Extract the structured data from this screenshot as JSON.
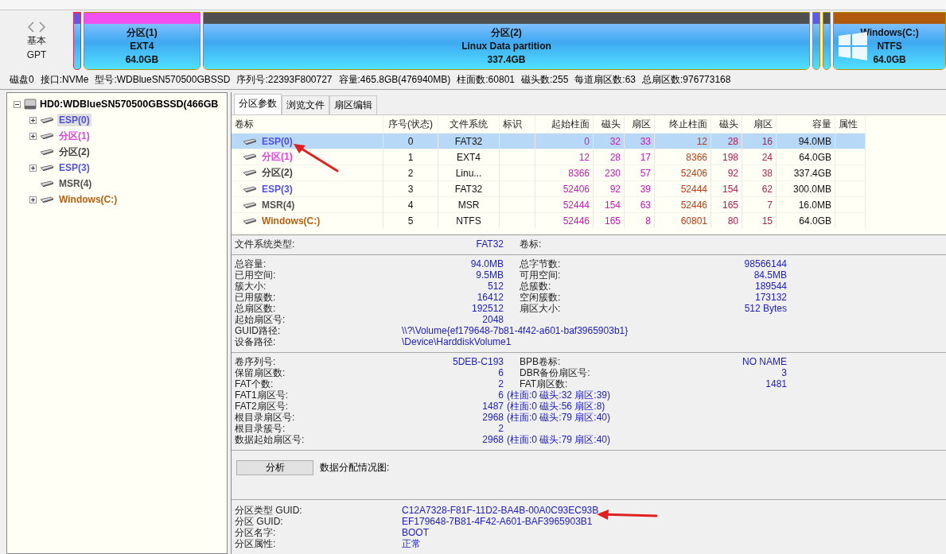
{
  "disk_map": {
    "style_label": [
      "基本",
      "GPT"
    ],
    "partitions": [
      {
        "kind": "small",
        "color": "#5a5af0",
        "selected": true
      },
      {
        "kind": "normal",
        "color": "#f050f0",
        "selected": false,
        "lines": [
          "分区(1)",
          "EXT4",
          "64.0GB"
        ]
      },
      {
        "kind": "normal",
        "color": "#505050",
        "selected": false,
        "lines": [
          "分区(2)",
          "Linux Data partition",
          "337.4GB"
        ]
      },
      {
        "kind": "small",
        "color": "#5a5af0",
        "selected": false
      },
      {
        "kind": "small",
        "color": "#505050",
        "selected": false
      },
      {
        "kind": "logo",
        "color": "#b05a10",
        "selected": false,
        "lines": [
          "Windows(C:)",
          "NTFS",
          "64.0GB"
        ]
      }
    ]
  },
  "disk_info": [
    "磁盘0",
    "接口:NVMe",
    "型号:WDBlueSN570500GBSSD",
    "序列号:22393F800727",
    "容量:465.8GB(476940MB)",
    "柱面数:60801",
    "磁头数:255",
    "每道扇区数:63",
    "总扇区数:976773168"
  ],
  "tree": {
    "label": "HD0:WDBlueSN570500GBSSD(466GB",
    "expanded": true,
    "children": [
      {
        "kind": "branch",
        "label": "ESP(0)",
        "color": "#5050e0",
        "selected": true
      },
      {
        "kind": "branch",
        "label": "分区(1)",
        "color": "#e040e0",
        "selected": false
      },
      {
        "kind": "leaf",
        "label": "分区(2)",
        "color": "#404040",
        "selected": false
      },
      {
        "kind": "branch",
        "label": "ESP(3)",
        "color": "#5050e0",
        "selected": false
      },
      {
        "kind": "leaf",
        "label": "MSR(4)",
        "color": "#505050",
        "selected": false
      },
      {
        "kind": "branch",
        "label": "Windows(C:)",
        "color": "#b86010",
        "selected": false
      }
    ]
  },
  "tabs": [
    {
      "label": "分区参数",
      "selected": true
    },
    {
      "label": "浏览文件",
      "selected": false
    },
    {
      "label": "扇区编辑",
      "selected": false
    }
  ],
  "table": {
    "columns": [
      "卷标",
      "序号(状态)",
      "文件系统",
      "标识",
      "起始柱面",
      "磁头",
      "扇区",
      "终止柱面",
      "磁头",
      "扇区",
      "容量",
      "属性"
    ],
    "rows": [
      {
        "selected": true,
        "color": "#5050e0",
        "cells": [
          "ESP(0)",
          "0",
          "FAT32",
          "",
          "0",
          "32",
          "33",
          "12",
          "28",
          "16",
          "94.0MB",
          ""
        ]
      },
      {
        "selected": false,
        "color": "#e040e0",
        "cells": [
          "分区(1)",
          "1",
          "EXT4",
          "",
          "12",
          "28",
          "17",
          "8366",
          "198",
          "24",
          "64.0GB",
          ""
        ]
      },
      {
        "selected": false,
        "color": "#404040",
        "cells": [
          "分区(2)",
          "2",
          "Linu...",
          "",
          "8366",
          "230",
          "57",
          "52406",
          "92",
          "38",
          "337.4GB",
          ""
        ]
      },
      {
        "selected": false,
        "color": "#5050e0",
        "cells": [
          "ESP(3)",
          "3",
          "FAT32",
          "",
          "52406",
          "92",
          "39",
          "52444",
          "154",
          "62",
          "300.0MB",
          ""
        ]
      },
      {
        "selected": false,
        "color": "#505050",
        "cells": [
          "MSR(4)",
          "4",
          "MSR",
          "",
          "52444",
          "154",
          "63",
          "52446",
          "165",
          "7",
          "16.0MB",
          ""
        ]
      },
      {
        "selected": false,
        "color": "#b86010",
        "cells": [
          "Windows(C:)",
          "5",
          "NTFS",
          "",
          "52446",
          "165",
          "8",
          "60801",
          "80",
          "15",
          "64.0GB",
          ""
        ]
      }
    ]
  },
  "details": [
    [
      {
        "label": "文件系统类型:",
        "value": "FAT32",
        "label2": "卷标:"
      }
    ],
    [
      {
        "label": "总容量:",
        "value": "94.0MB",
        "label2": "总字节数:",
        "value2": "98566144"
      },
      {
        "label": "已用空间:",
        "value": "9.5MB",
        "label2": "可用空间:",
        "value2": "84.5MB"
      },
      {
        "label": "簇大小:",
        "value": "512",
        "label2": "总簇数:",
        "value2": "189544"
      },
      {
        "label": "已用簇数:",
        "value": "16412",
        "label2": "空闲簇数:",
        "value2": "173132"
      },
      {
        "label": "总扇区数:",
        "value": "192512",
        "label2": "扇区大小:",
        "value2": "512 Bytes"
      },
      {
        "label": "起始扇区号:",
        "value": "2048"
      },
      {
        "label": "GUID路径:",
        "wide": "\\\\?\\Volume{ef179648-7b81-4f42-a601-baf3965903b1}"
      },
      {
        "label": "设备路径:",
        "wide": "\\Device\\HarddiskVolume1"
      }
    ],
    [
      {
        "label": "卷序列号:",
        "value": "5DEB-C193",
        "label2": "BPB卷标:",
        "value2": "NO NAME"
      },
      {
        "label": "保留扇区数:",
        "value": "6",
        "label2": "DBR备份扇区号:",
        "value2": "3"
      },
      {
        "label": "FAT个数:",
        "value": "2",
        "label2": "FAT扇区数:",
        "value2": "1481"
      },
      {
        "label": "FAT1扇区号:",
        "value": "6",
        "note": "(柱面:0 磁头:32 扇区:39)"
      },
      {
        "label": "FAT2扇区号:",
        "value": "1487",
        "note": "(柱面:0 磁头:56 扇区:8)"
      },
      {
        "label": "根目录扇区号:",
        "value": "2968",
        "note": "(柱面:0 磁头:79 扇区:40)"
      },
      {
        "label": "根目录簇号:",
        "value": "2"
      },
      {
        "label": "数据起始扇区号:",
        "value": "2968",
        "note": "(柱面:0 磁头:79 扇区:40)"
      }
    ]
  ],
  "analysis": {
    "button": "分析",
    "label": "数据分配情况图:"
  },
  "guid_info": [
    {
      "label": "分区类型 GUID:",
      "value": "C12A7328-F81F-11D2-BA4B-00A0C93EC93B"
    },
    {
      "label": "分区 GUID:",
      "value": "EF179648-7B81-4F42-A601-BAF3965903B1"
    },
    {
      "label": "分区名字:",
      "value": "BOOT"
    },
    {
      "label": "分区属性:",
      "value": "正常"
    }
  ]
}
